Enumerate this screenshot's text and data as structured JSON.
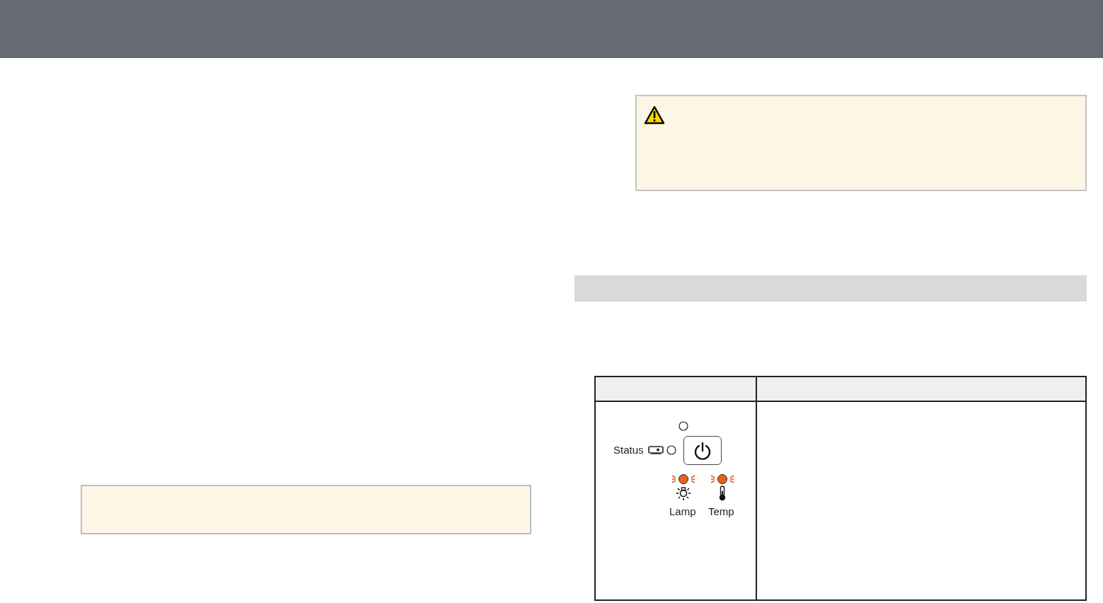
{
  "indicator_panel": {
    "status": {
      "label": "Status",
      "on": false
    },
    "power": {
      "on": false
    },
    "lamp": {
      "label": "Lamp",
      "on": true
    },
    "temp": {
      "label": "Temp",
      "on": true
    }
  }
}
